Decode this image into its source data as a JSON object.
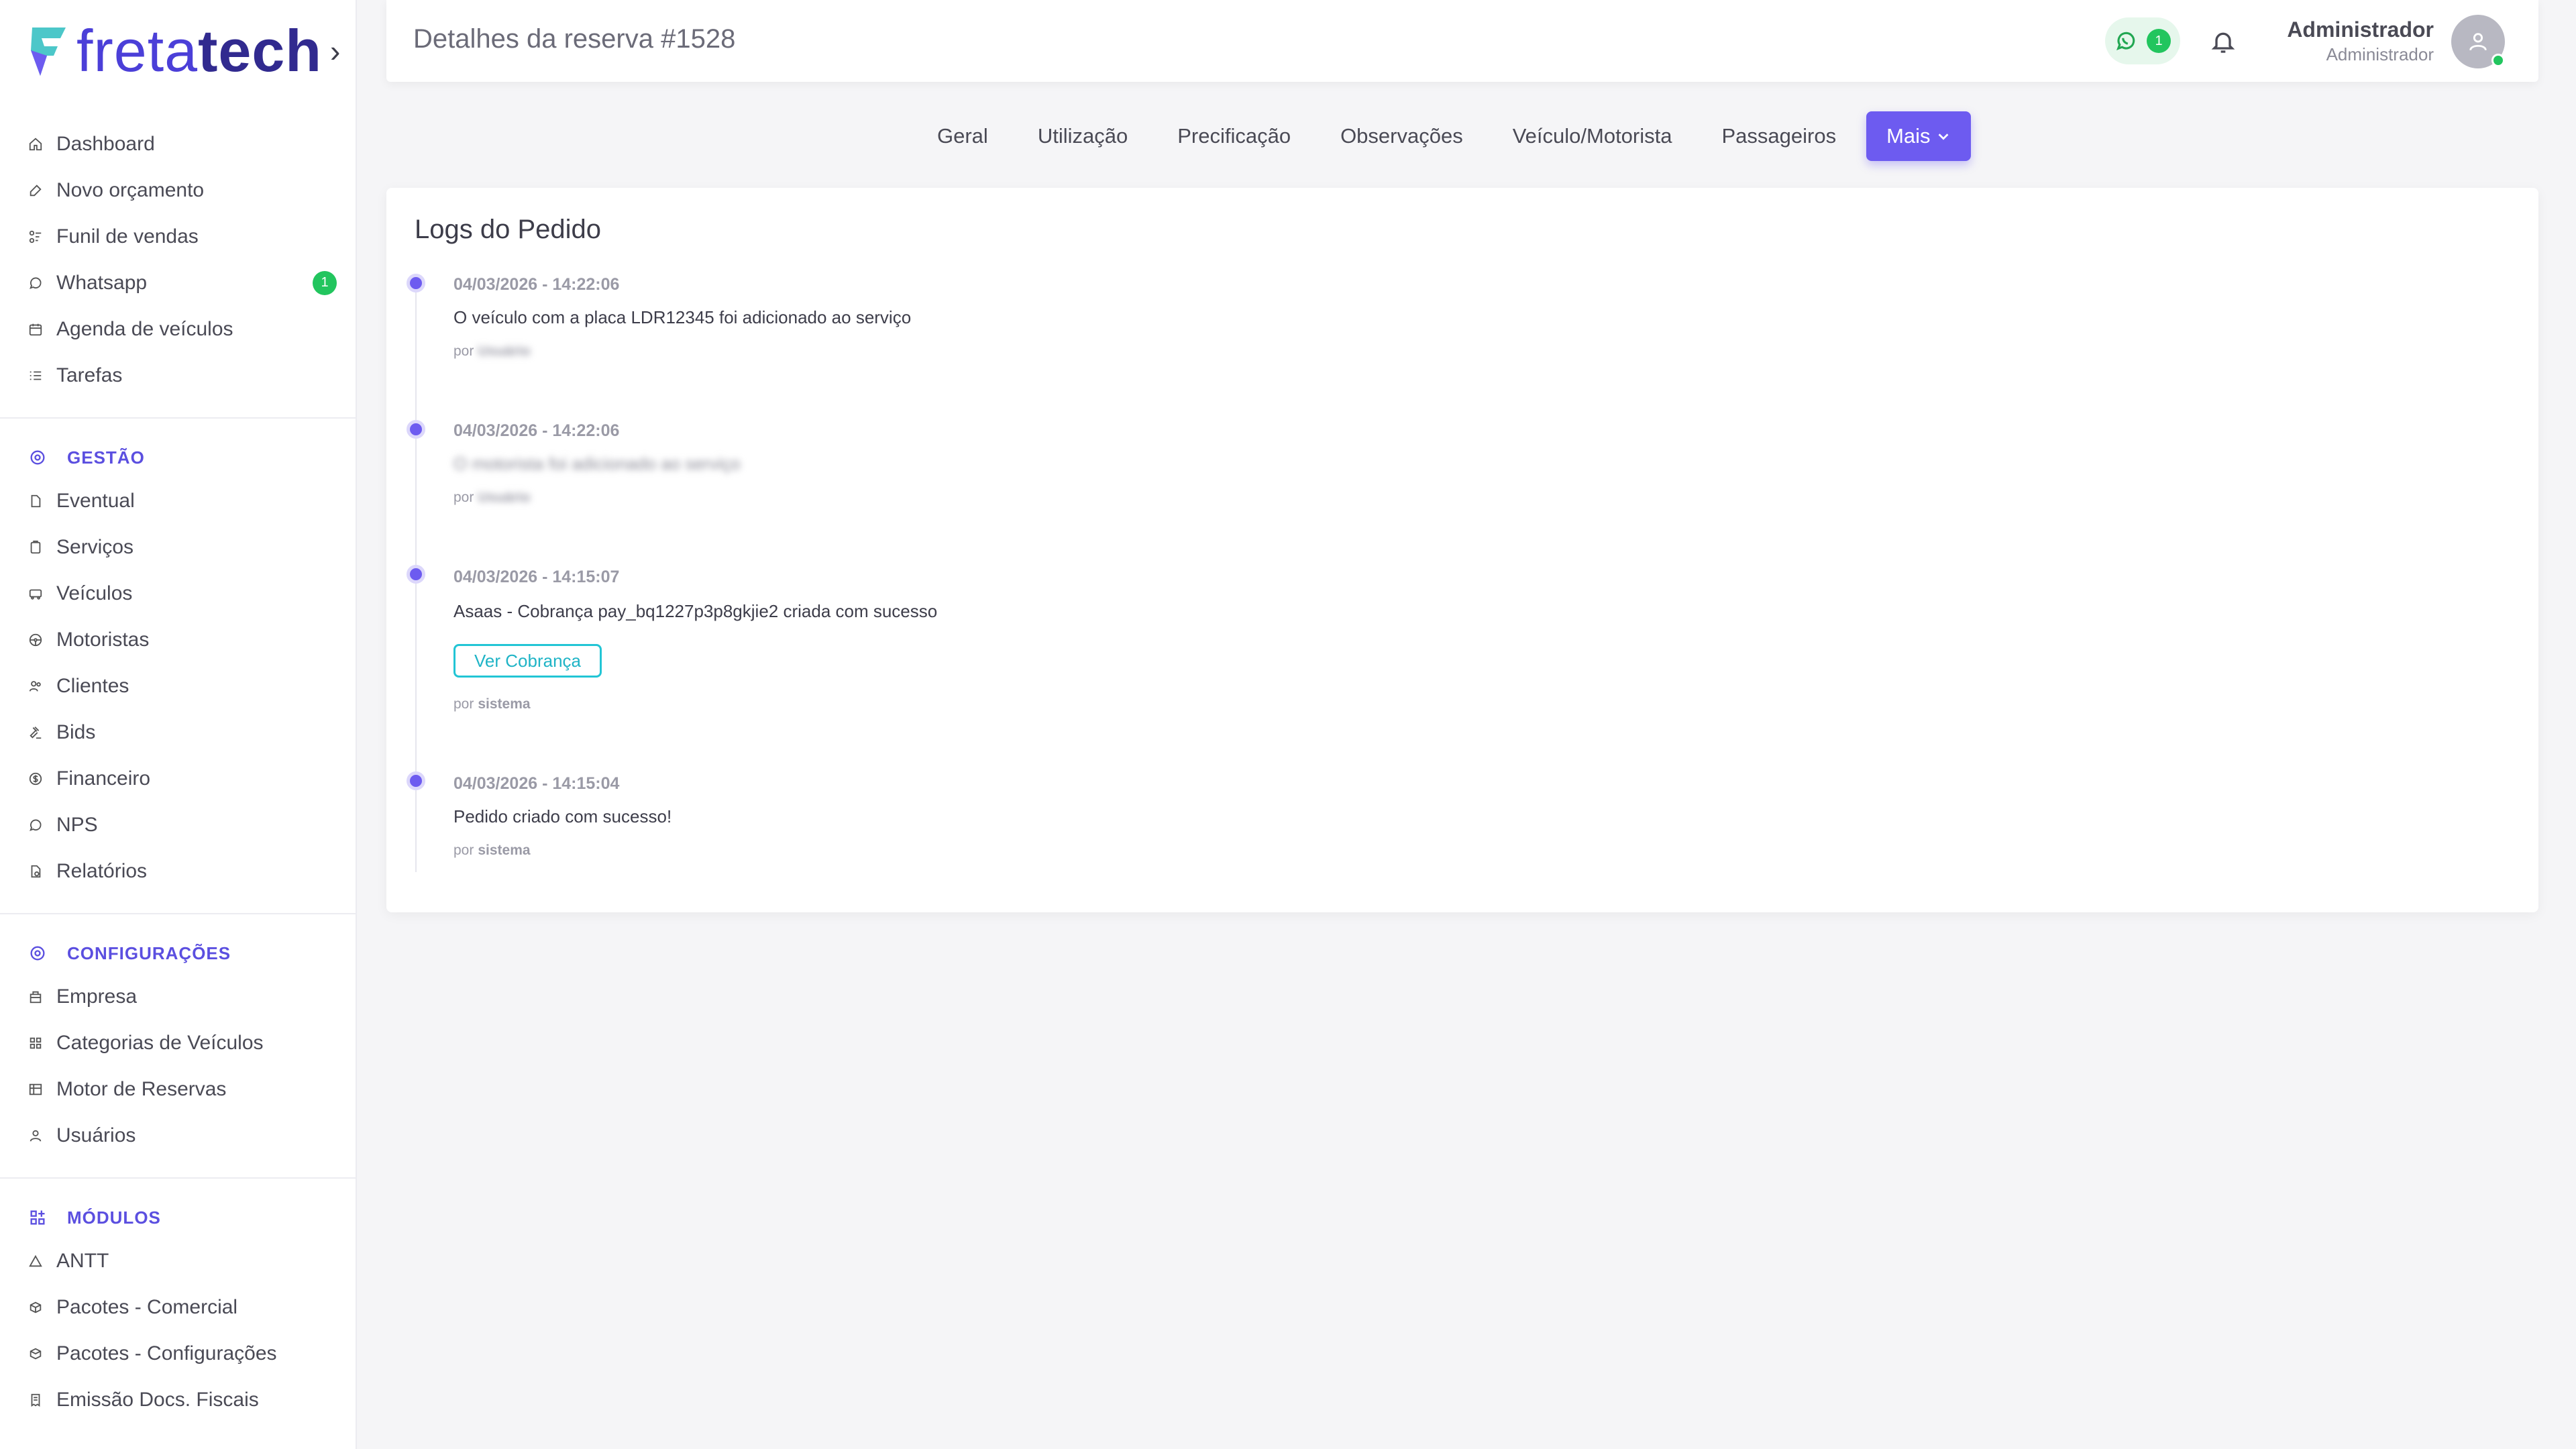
{
  "brand": {
    "logo_text_a": "freta",
    "logo_text_b": "tech"
  },
  "sidebar": {
    "main_items": [
      {
        "label": "Dashboard",
        "icon": "home-icon"
      },
      {
        "label": "Novo orçamento",
        "icon": "edit-icon"
      },
      {
        "label": "Funil de vendas",
        "icon": "funnel-icon"
      },
      {
        "label": "Whatsapp",
        "icon": "whatsapp-icon",
        "badge": "1"
      },
      {
        "label": "Agenda de veículos",
        "icon": "calendar-icon"
      },
      {
        "label": "Tarefas",
        "icon": "list-icon"
      }
    ],
    "gestao": {
      "title": "GESTÃO",
      "items": [
        {
          "label": "Eventual",
          "icon": "document-icon"
        },
        {
          "label": "Serviços",
          "icon": "clipboard-icon"
        },
        {
          "label": "Veículos",
          "icon": "bus-icon"
        },
        {
          "label": "Motoristas",
          "icon": "steering-wheel-icon"
        },
        {
          "label": "Clientes",
          "icon": "users-icon"
        },
        {
          "label": "Bids",
          "icon": "gavel-icon"
        },
        {
          "label": "Financeiro",
          "icon": "dollar-icon"
        },
        {
          "label": "NPS",
          "icon": "chat-icon"
        },
        {
          "label": "Relatórios",
          "icon": "report-icon"
        }
      ]
    },
    "configuracoes": {
      "title": "CONFIGURAÇÕES",
      "items": [
        {
          "label": "Empresa",
          "icon": "building-icon"
        },
        {
          "label": "Categorias de Veículos",
          "icon": "grid-icon"
        },
        {
          "label": "Motor de Reservas",
          "icon": "table-icon"
        },
        {
          "label": "Usuários",
          "icon": "user-icon"
        }
      ]
    },
    "modulos": {
      "title": "MÓDULOS",
      "items": [
        {
          "label": "ANTT",
          "icon": "triangle-icon"
        },
        {
          "label": "Pacotes - Comercial",
          "icon": "package-icon"
        },
        {
          "label": "Pacotes - Configurações",
          "icon": "package-settings-icon"
        },
        {
          "label": "Emissão Docs. Fiscais",
          "icon": "receipt-icon"
        }
      ]
    }
  },
  "header": {
    "title": "Detalhes da reserva #1528",
    "whatsapp_count": "1",
    "user_name": "Administrador",
    "user_role": "Administrador"
  },
  "tabs": {
    "items": [
      "Geral",
      "Utilização",
      "Precificação",
      "Observações",
      "Veículo/Motorista",
      "Passageiros"
    ],
    "active": "Mais"
  },
  "logs": {
    "title": "Logs do Pedido",
    "by_prefix": "por",
    "entries": [
      {
        "date": "04/03/2026 - 14:22:06",
        "message": "O veículo com a placa LDR12345 foi adicionado ao serviço",
        "by": "Usuário"
      },
      {
        "date": "04/03/2026 - 14:22:06",
        "message": "O motorista foi adicionado ao serviço",
        "by": "Usuário"
      },
      {
        "date": "04/03/2026 - 14:15:07",
        "message": "Asaas - Cobrança pay_bq1227p3p8gkjie2 criada com sucesso",
        "button": "Ver Cobrança",
        "by": "sistema"
      },
      {
        "date": "04/03/2026 - 14:15:04",
        "message": "Pedido criado com sucesso!",
        "by": "sistema"
      }
    ]
  },
  "colors": {
    "accent": "#6d5bf0",
    "success": "#22c55e",
    "cyan": "#22c5d5"
  }
}
